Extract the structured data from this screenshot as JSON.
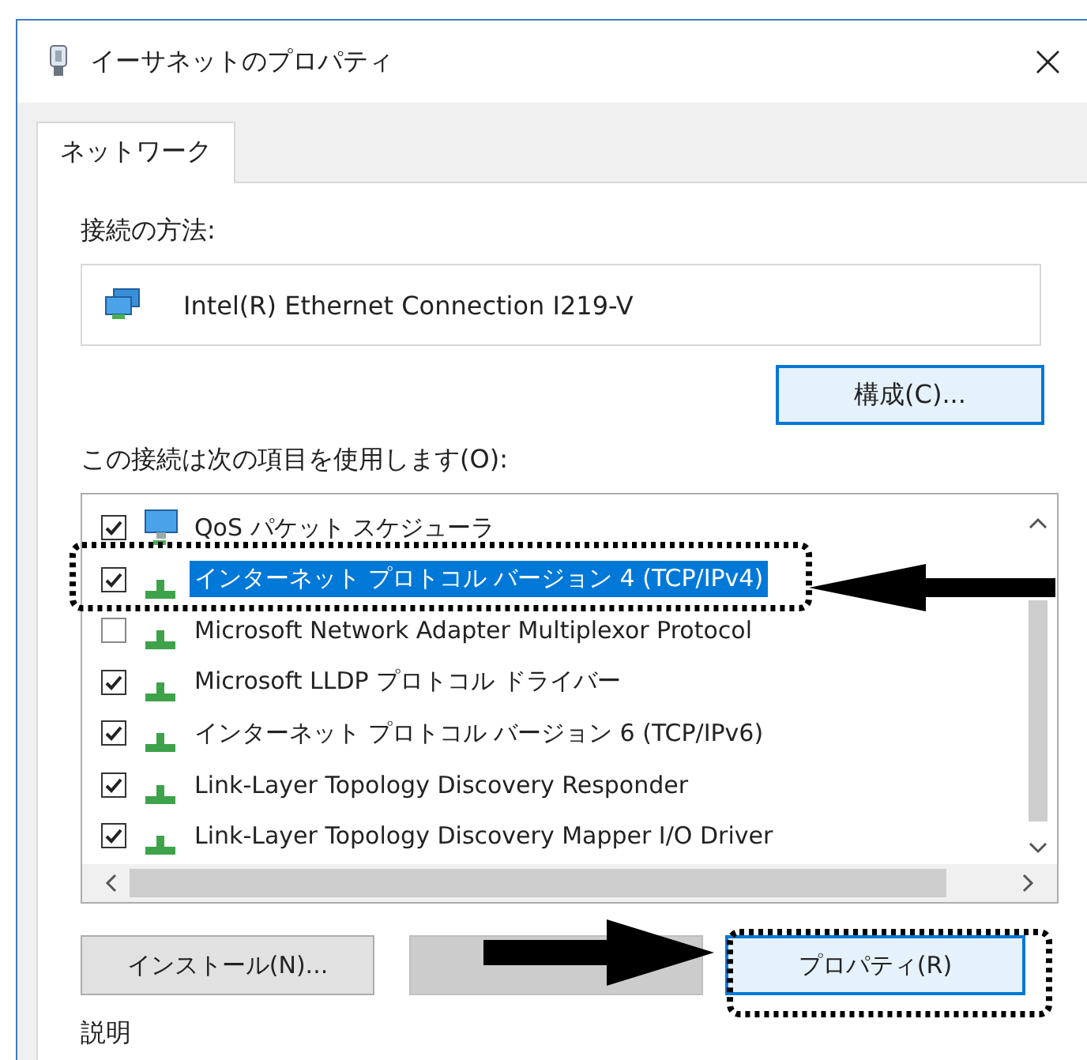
{
  "window": {
    "title": "イーサネットのプロパティ",
    "close": "×"
  },
  "tabs": [
    {
      "label": "ネットワーク",
      "selected": true
    }
  ],
  "connection": {
    "label": "接続の方法:",
    "adapter": "Intel(R) Ethernet Connection I219-V"
  },
  "configure_button": "構成(C)...",
  "items_label": "この接続は次の項目を使用します(O):",
  "items": [
    {
      "kind": "service",
      "label": "QoS パケット スケジューラ",
      "checked": true,
      "selected": false
    },
    {
      "kind": "protocol",
      "label": "インターネット プロトコル バージョン 4 (TCP/IPv4)",
      "checked": true,
      "selected": true
    },
    {
      "kind": "protocol",
      "label": "Microsoft Network Adapter Multiplexor Protocol",
      "checked": false,
      "selected": false
    },
    {
      "kind": "protocol",
      "label": "Microsoft LLDP プロトコル ドライバー",
      "checked": true,
      "selected": false
    },
    {
      "kind": "protocol",
      "label": "インターネット プロトコル バージョン 6 (TCP/IPv6)",
      "checked": true,
      "selected": false
    },
    {
      "kind": "protocol",
      "label": "Link-Layer Topology Discovery Responder",
      "checked": true,
      "selected": false
    },
    {
      "kind": "protocol",
      "label": "Link-Layer Topology Discovery Mapper I/O Driver",
      "checked": true,
      "selected": false
    }
  ],
  "buttons": [
    {
      "label": "インストール(N)...",
      "disabled": false,
      "focused": false
    },
    {
      "disabled": true,
      "focused": false
    },
    {
      "label": "プロパティ(R)",
      "disabled": false,
      "focused": true
    }
  ],
  "description_label": "説明"
}
